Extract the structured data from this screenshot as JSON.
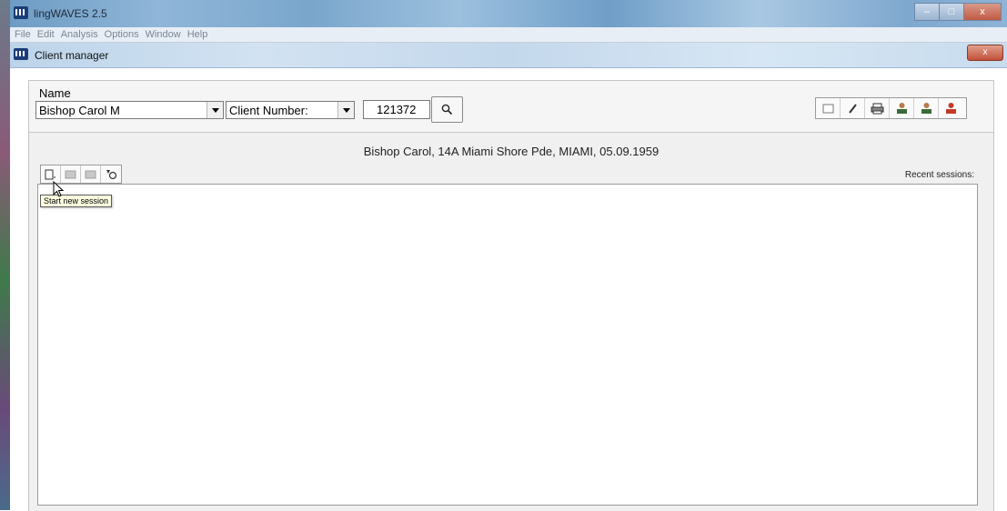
{
  "app": {
    "title": "lingWAVES 2.5",
    "controls": [
      "minimize-icon",
      "maximize-icon",
      "close-icon"
    ]
  },
  "menu": [
    "File",
    "Edit",
    "Analysis",
    "Options",
    "Window",
    "Help"
  ],
  "child_window": {
    "title": "Client manager"
  },
  "client": {
    "name_label": "Name",
    "name_value": "Bishop Carol M",
    "lookup_field": "Client Number:",
    "number_value": "121372",
    "info": "Bishop Carol, 14A Miami Shore Pde, MIAMI, 05.09.1959"
  },
  "toolbar_icons": [
    "new-client-icon",
    "edit-client-icon",
    "print-icon",
    "client-group-icon",
    "client-search-icon",
    "client-remove-icon"
  ],
  "sessions": {
    "recent_label": "Recent sessions:",
    "tool_icons": [
      "new-session-icon",
      "open-session-icon",
      "delete-session-icon",
      "session-settings-icon"
    ],
    "tooltip": "Start new session"
  },
  "colors": {
    "titlebar": "#7aa6cc",
    "tooltip_bg": "#ffffe1",
    "close_button": "#c4503a"
  }
}
